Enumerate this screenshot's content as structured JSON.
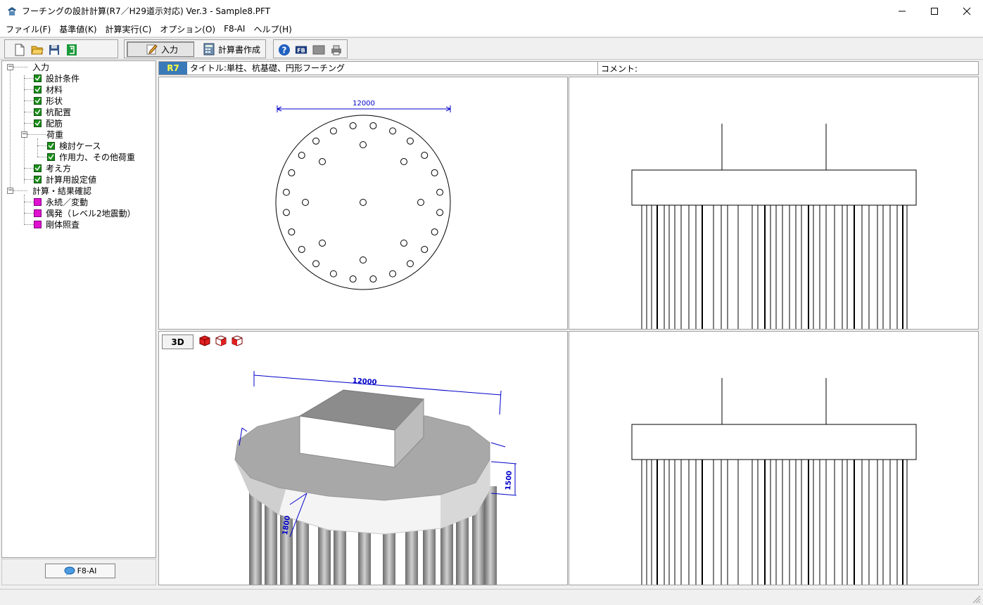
{
  "window": {
    "title": "フーチングの設計計算(R7／H29道示対応) Ver.3 - Sample8.PFT",
    "icons": {
      "app": "footing-app-icon",
      "minimize": "minimize-icon",
      "maximize": "maximize-icon",
      "close": "close-icon"
    }
  },
  "menu": [
    "ファイル(F)",
    "基準値(K)",
    "計算実行(C)",
    "オプション(O)",
    "F8-AI",
    "ヘルプ(H)"
  ],
  "toolbar": {
    "file_icons": [
      "new-file-icon",
      "open-folder-icon",
      "save-icon",
      "exit-icon"
    ],
    "input_label": "入力",
    "report_label": "計算書作成",
    "help_icons": [
      "help-icon",
      "fb-icon",
      "screen-icon",
      "print-icon"
    ]
  },
  "tree": {
    "input_root": "入力",
    "design_conditions": "設計条件",
    "material": "材料",
    "shape": "形状",
    "pile_layout": "杭配置",
    "rebar": "配筋",
    "loads": "荷重",
    "check_cases": "検討ケース",
    "acting_forces": "作用力、その他荷重",
    "approach": "考え方",
    "calc_settings": "計算用設定値",
    "calc_root": "計算・結果確認",
    "permanent": "永続／変動",
    "accidental": "偶発（レベル2地震動）",
    "rigid_check": "剛体照査"
  },
  "f8_button": "F8-AI",
  "info": {
    "badge": "R7",
    "title": "タイトル:単柱、杭基礎、円形フーチング",
    "comment": "コメント:"
  },
  "views": {
    "plan_dimension": "12000",
    "threed_button": "3D",
    "threed_dimension_top": "12000",
    "threed_dimension_side": "1500",
    "threed_dimension_col": "1800"
  },
  "colors": {
    "dimension": "#0000c8",
    "badge_bg": "#3a7ab8",
    "badge_text": "#ffff40",
    "check": "#1a8f1a",
    "result": "#e010d0"
  }
}
